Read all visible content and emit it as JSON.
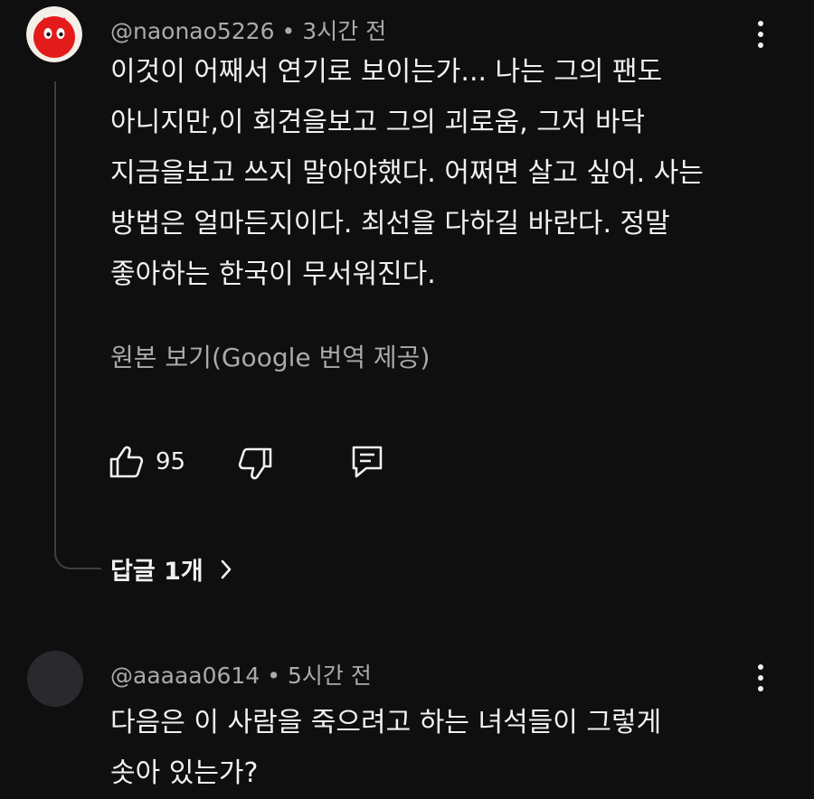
{
  "comments": [
    {
      "author": "@naonao5226",
      "time": "3시간 전",
      "avatar_color": "#e41b1b",
      "lines": [
        "이것이 어째서 연기로 보이는가... 나는 그의 팬도",
        "아니지만,이 회견을보고 그의 괴로움, 그저 바닥",
        "지금을보고 쓰지 말아야했다. 어쩌면 살고 싶어. 사는",
        "방법은 얼마든지이다. 최선을 다하길 바란다. 정말",
        "좋아하는 한국이 무서워진다."
      ],
      "translate_label": "원본 보기(Google 번역 제공)",
      "likes": "95",
      "replies_label": "답글 1개",
      "icons": [
        "thumb-up-icon",
        "thumb-down-icon",
        "reply-icon",
        "more-vert-icon",
        "chevron-right-icon"
      ]
    },
    {
      "author": "@aaaaa0614",
      "time": "5시간 전",
      "avatar_color": "#2a2a2e",
      "lines": [
        "다음은 이 사람을 죽으려고 하는 녀석들이 그렇게",
        "솟아 있는가?"
      ],
      "icons": [
        "more-vert-icon"
      ]
    }
  ],
  "separator": "•",
  "colors": {
    "background": "#0f0f0f",
    "primary_text": "#f1f1f1",
    "secondary_text": "#aaaaaa",
    "thread_line": "#3f3f3f"
  }
}
